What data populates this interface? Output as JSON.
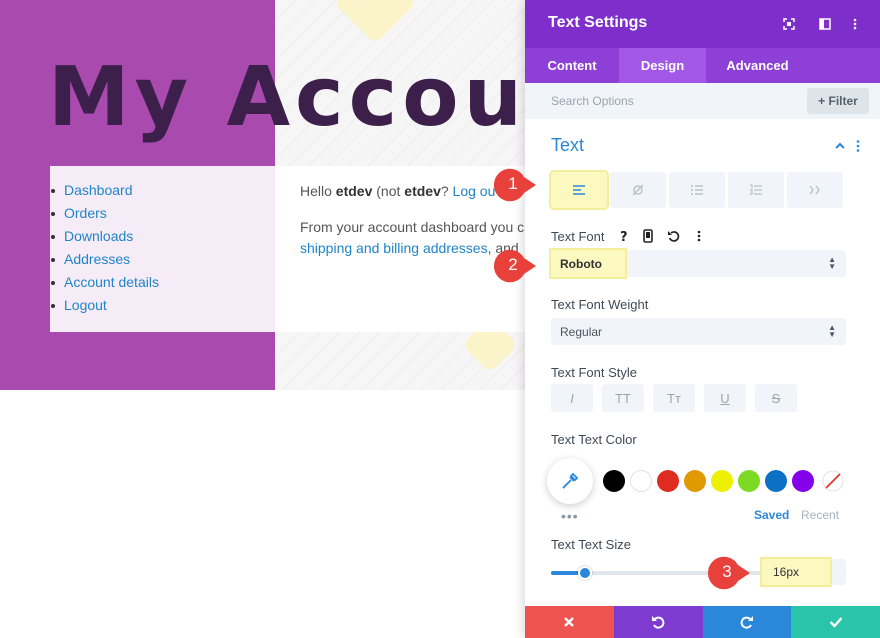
{
  "page": {
    "title": "My Accoun",
    "nav_items": [
      {
        "label": "Dashboard"
      },
      {
        "label": "Orders"
      },
      {
        "label": "Downloads"
      },
      {
        "label": "Addresses"
      },
      {
        "label": "Account details"
      },
      {
        "label": "Logout"
      }
    ],
    "hello": {
      "prefix": "Hello ",
      "user": "etdev",
      "middle": " (not ",
      "user2": "etdev",
      "end": "? ",
      "logout_link": "Log ou"
    },
    "paragraph": {
      "line1": "From your account dashboard you c",
      "link": "shipping and billing addresses",
      "line2_end": ", and"
    }
  },
  "panel": {
    "title": "Text Settings",
    "header_icons": [
      "fullscreen-icon",
      "split-view-icon",
      "more-options-icon"
    ],
    "tabs": [
      {
        "label": "Content",
        "active": false
      },
      {
        "label": "Design",
        "active": true
      },
      {
        "label": "Advanced",
        "active": false
      }
    ],
    "search": {
      "placeholder": "Search Options",
      "filter_label": "Filter"
    },
    "section": {
      "title": "Text"
    },
    "alignment_icons": [
      "align-left-icon",
      "no-link-icon",
      "bullet-list-icon",
      "numbered-list-icon",
      "quote-icon"
    ],
    "text_font": {
      "label": "Text Font",
      "value": "Roboto"
    },
    "text_font_weight": {
      "label": "Text Font Weight",
      "value": "Regular"
    },
    "text_font_style": {
      "label": "Text Font Style",
      "buttons": [
        "I",
        "TT",
        "Tт",
        "U",
        "S"
      ]
    },
    "text_color": {
      "label": "Text Text Color",
      "swatches": [
        "#000000",
        "#ffffff",
        "#e02b20",
        "#e09900",
        "#edf000",
        "#7cda24",
        "#0c71c3",
        "#8300e9"
      ],
      "saved_label": "Saved",
      "recent_label": "Recent"
    },
    "text_size": {
      "label": "Text Text Size",
      "value": "16px",
      "slider_fraction": 0.16
    },
    "footer": [
      "close-icon",
      "undo-icon",
      "redo-icon",
      "check-icon"
    ]
  },
  "callouts": [
    "1",
    "2",
    "3"
  ],
  "colors": {
    "purple_header": "#7e2fcb",
    "purple_tabs": "#8d3fd8",
    "accent_blue": "#2b87da",
    "hero_purple": "#a94aae",
    "highlight": "#fbf8c0",
    "marker_red": "#e8403a",
    "footer_red": "#ef5350",
    "footer_purple": "#7e3bd0",
    "footer_blue": "#2b87da",
    "footer_teal": "#29c4a9"
  }
}
